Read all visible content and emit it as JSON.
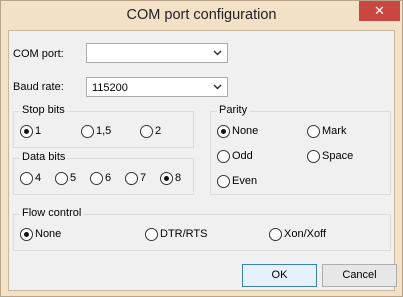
{
  "window": {
    "title": "COM port configuration"
  },
  "com_port": {
    "label": "COM port:",
    "value": ""
  },
  "baud_rate": {
    "label": "Baud rate:",
    "value": "115200"
  },
  "stop_bits": {
    "legend": "Stop bits",
    "options": [
      {
        "label": "1",
        "selected": true
      },
      {
        "label": "1,5",
        "selected": false
      },
      {
        "label": "2",
        "selected": false
      }
    ]
  },
  "parity": {
    "legend": "Parity",
    "options": [
      {
        "label": "None",
        "selected": true
      },
      {
        "label": "Mark",
        "selected": false
      },
      {
        "label": "Odd",
        "selected": false
      },
      {
        "label": "Space",
        "selected": false
      },
      {
        "label": "Even",
        "selected": false
      }
    ]
  },
  "data_bits": {
    "legend": "Data bits",
    "options": [
      {
        "label": "4",
        "selected": false
      },
      {
        "label": "5",
        "selected": false
      },
      {
        "label": "6",
        "selected": false
      },
      {
        "label": "7",
        "selected": false
      },
      {
        "label": "8",
        "selected": true
      }
    ]
  },
  "flow_control": {
    "legend": "Flow control",
    "options": [
      {
        "label": "None",
        "selected": true
      },
      {
        "label": "DTR/RTS",
        "selected": false
      },
      {
        "label": "Xon/Xoff",
        "selected": false
      }
    ]
  },
  "buttons": {
    "ok": "OK",
    "cancel": "Cancel"
  },
  "icons": {
    "close": "close-icon",
    "dropdown": "chevron-down-icon"
  }
}
